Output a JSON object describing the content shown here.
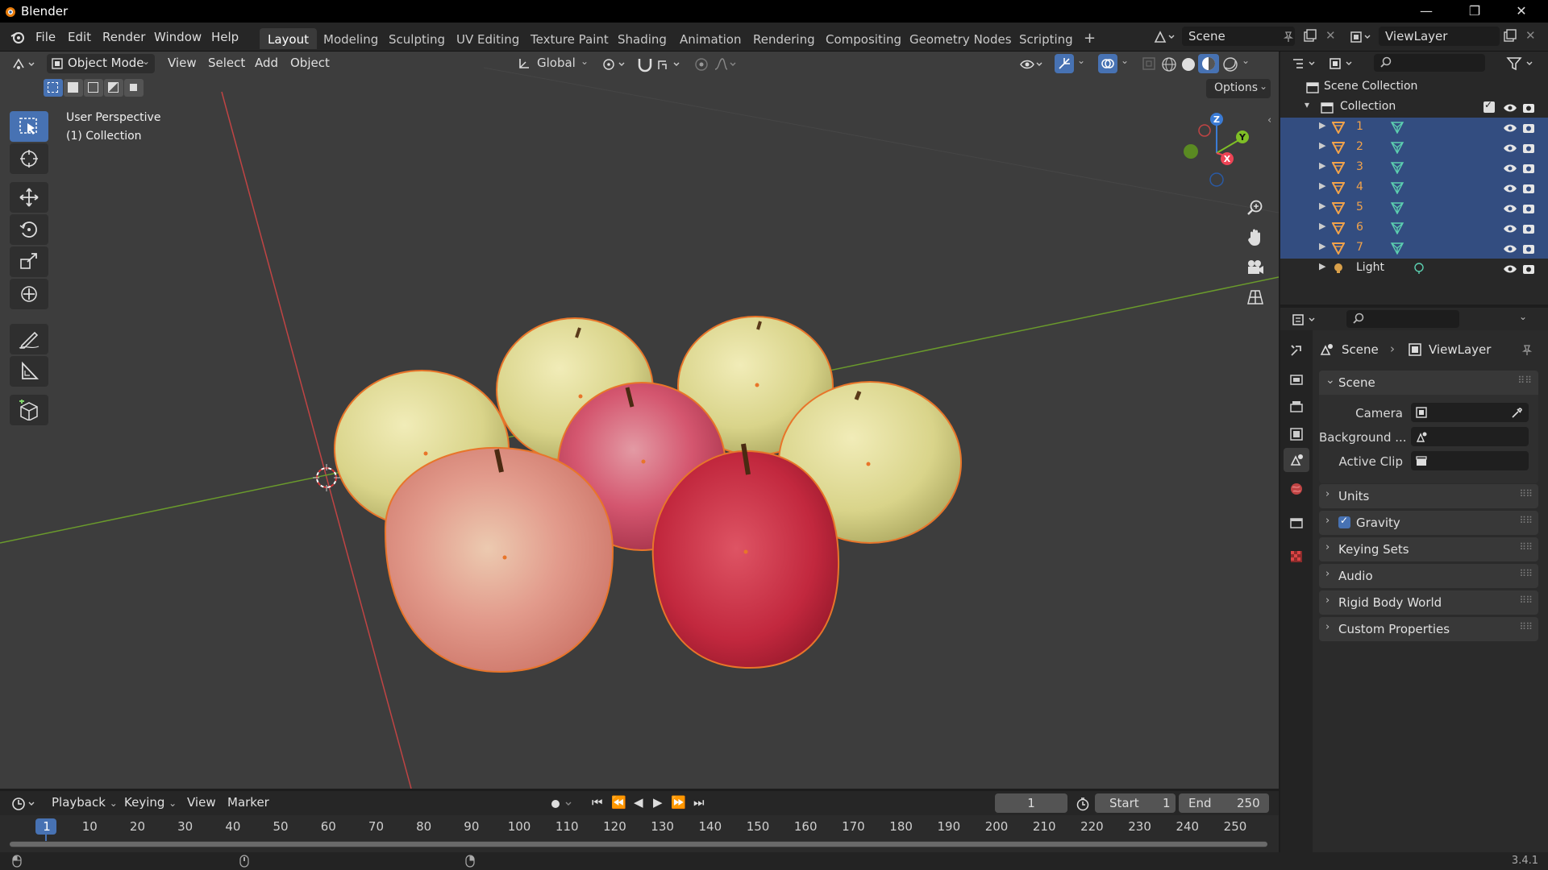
{
  "titlebar": {
    "title": "Blender",
    "minimize": "—",
    "maximize": "❐",
    "close": "✕"
  },
  "menu": [
    "File",
    "Edit",
    "Render",
    "Window",
    "Help"
  ],
  "workspaces": [
    "Layout",
    "Modeling",
    "Sculpting",
    "UV Editing",
    "Texture Paint",
    "Shading",
    "Animation",
    "Rendering",
    "Compositing",
    "Geometry Nodes",
    "Scripting"
  ],
  "workspace_add": "+",
  "scene_field": "Scene",
  "viewlayer_field": "ViewLayer",
  "viewport": {
    "mode": "Object Mode",
    "menus": [
      "View",
      "Select",
      "Add",
      "Object"
    ],
    "transform_orientation": "Global",
    "options": "Options",
    "overlay_line1": "User Perspective",
    "overlay_line2": "(1) Collection",
    "gizmo": {
      "z": "Z",
      "y": "Y",
      "x": "X"
    }
  },
  "outliner": {
    "root": "Scene Collection",
    "collection": "Collection",
    "objects": [
      "1",
      "2",
      "3",
      "4",
      "5",
      "6",
      "7"
    ],
    "light": "Light"
  },
  "properties": {
    "breadcrumb_scene": "Scene",
    "breadcrumb_viewlayer": "ViewLayer",
    "section": "Scene",
    "camera_label": "Camera",
    "background_label": "Background ...",
    "active_clip_label": "Active Clip",
    "panels": [
      "Units",
      "Gravity",
      "Keying Sets",
      "Audio",
      "Rigid Body World",
      "Custom Properties"
    ],
    "gravity_checked": true
  },
  "timeline": {
    "menus": [
      "Playback",
      "Keying",
      "View",
      "Marker"
    ],
    "current_frame": "1",
    "start_label": "Start",
    "start_value": "1",
    "end_label": "End",
    "end_value": "250",
    "ticks": [
      "1",
      "10",
      "20",
      "30",
      "40",
      "50",
      "60",
      "70",
      "80",
      "90",
      "100",
      "110",
      "120",
      "130",
      "140",
      "150",
      "160",
      "170",
      "180",
      "190",
      "200",
      "210",
      "220",
      "230",
      "240",
      "250"
    ]
  },
  "status": {
    "version": "3.4.1"
  },
  "colors": {
    "accent": "#4772b3",
    "selection": "#334d80",
    "outline": "#e8752a",
    "x_axis": "#c04444",
    "y_axis": "#6a9a2c"
  }
}
